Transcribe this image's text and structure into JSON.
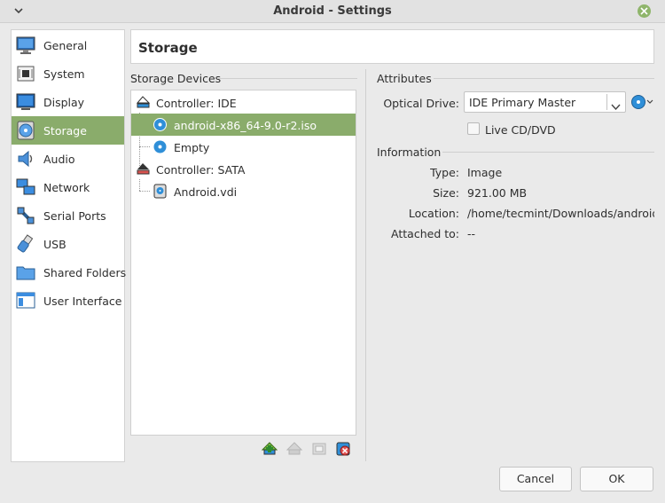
{
  "window": {
    "title": "Android - Settings"
  },
  "sidebar": {
    "items": [
      {
        "label": "General",
        "icon": "monitor-general-icon"
      },
      {
        "label": "System",
        "icon": "chip-icon"
      },
      {
        "label": "Display",
        "icon": "display-icon"
      },
      {
        "label": "Storage",
        "icon": "storage-disc-icon",
        "active": true
      },
      {
        "label": "Audio",
        "icon": "speaker-icon"
      },
      {
        "label": "Network",
        "icon": "network-icon"
      },
      {
        "label": "Serial Ports",
        "icon": "serial-port-icon"
      },
      {
        "label": "USB",
        "icon": "usb-icon"
      },
      {
        "label": "Shared Folders",
        "icon": "folder-icon"
      },
      {
        "label": "User Interface",
        "icon": "user-interface-icon"
      }
    ]
  },
  "header": {
    "title": "Storage"
  },
  "storage_devices": {
    "title": "Storage Devices",
    "tree": [
      {
        "label": "Controller: IDE",
        "icon": "ide-controller-icon"
      },
      {
        "label": "android-x86_64-9.0-r2.iso",
        "icon": "optical-disc-icon",
        "selected": true
      },
      {
        "label": "Empty",
        "icon": "optical-disc-icon"
      },
      {
        "label": "Controller: SATA",
        "icon": "sata-controller-icon"
      },
      {
        "label": "Android.vdi",
        "icon": "hard-disk-icon"
      }
    ]
  },
  "attributes": {
    "title": "Attributes",
    "optical_drive_label": "Optical Drive:",
    "optical_drive_value": "IDE Primary Master",
    "live_cd_label": "Live CD/DVD",
    "live_cd_checked": false
  },
  "information": {
    "title": "Information",
    "rows": [
      {
        "label": "Type:",
        "value": "Image"
      },
      {
        "label": "Size:",
        "value": "921.00 MB"
      },
      {
        "label": "Location:",
        "value": "/home/tecmint/Downloads/android..."
      },
      {
        "label": "Attached to:",
        "value": "--"
      }
    ]
  },
  "buttons": {
    "cancel": "Cancel",
    "ok": "OK"
  },
  "colors": {
    "accent": "#8aac6b",
    "close": "#8fb56b",
    "disc": "#2f8fd8"
  }
}
